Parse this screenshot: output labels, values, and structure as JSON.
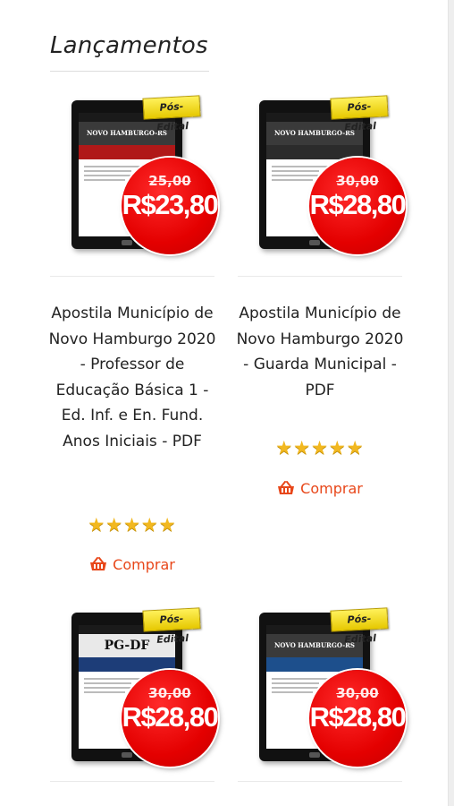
{
  "section": {
    "title": "Lançamentos"
  },
  "products": [
    {
      "badge": "Pós-Edital",
      "cover_title": "NOVO HAMBURGO-RS",
      "old_price": "25,00",
      "price": "R$23,80",
      "name": "Apostila Município de Novo Hamburgo 2020 - Professor de Educação Básica 1 - Ed. Inf. e En. Fund. Anos Iniciais - PDF",
      "rating": "★★★★★",
      "buy_label": "Comprar",
      "cover_color": "#b01818"
    },
    {
      "badge": "Pós-Edital",
      "cover_title": "NOVO HAMBURGO-RS",
      "old_price": "30,00",
      "price": "R$28,80",
      "name": "Apostila Município de Novo Hamburgo 2020 - Guarda Municipal - PDF",
      "rating": "★★★★★",
      "buy_label": "Comprar",
      "cover_color": "#2b2b2b"
    },
    {
      "badge": "Pós-Edital",
      "cover_title": "PG-DF",
      "old_price": "30,00",
      "price": "R$28,80",
      "cover_color": "#1d3d78"
    },
    {
      "badge": "Pós-Edital",
      "cover_title": "NOVO HAMBURGO-RS",
      "old_price": "30,00",
      "price": "R$28,80",
      "cover_color": "#1d4f8c"
    }
  ],
  "colors": {
    "price_red": "#e40000",
    "buy_orange": "#e8471a",
    "star_gold": "#f2b820",
    "badge_yellow": "#fff15a"
  }
}
